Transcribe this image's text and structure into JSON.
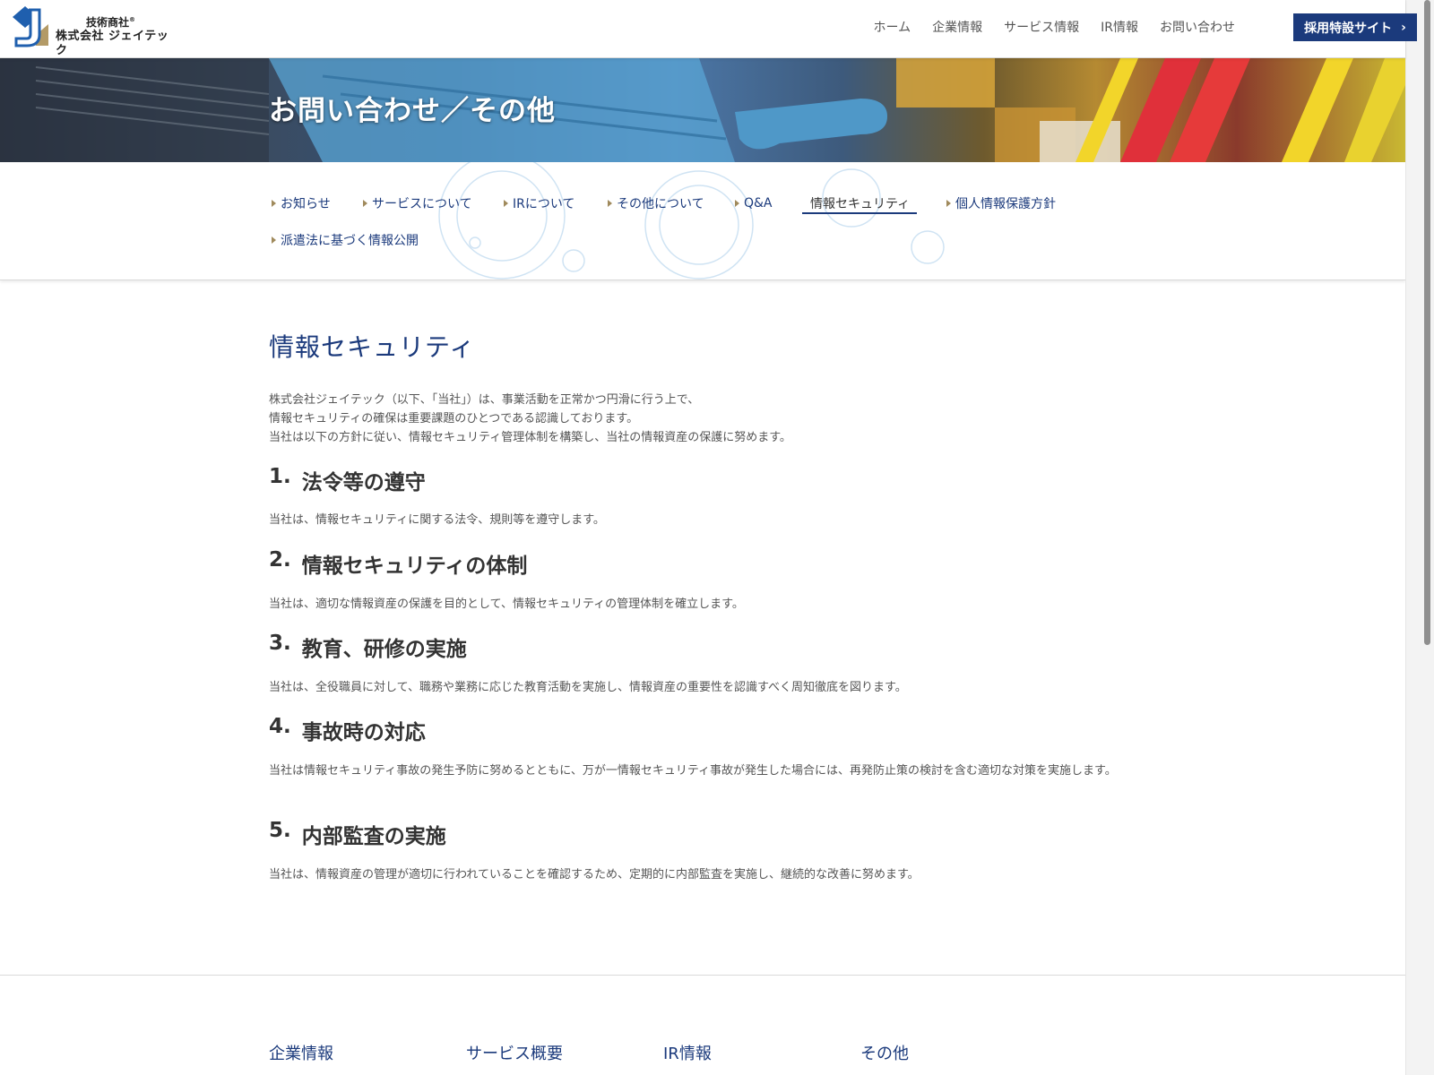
{
  "header": {
    "logo": {
      "tagline": "技術商社",
      "registered_mark": "®",
      "company_name": "株式会社 ジェイテック"
    },
    "nav": [
      {
        "label": "ホーム"
      },
      {
        "label": "企業情報"
      },
      {
        "label": "サービス情報"
      },
      {
        "label": "IR情報"
      },
      {
        "label": "お問い合わせ"
      }
    ],
    "recruit_button": {
      "label": "採用特設サイト",
      "icon": "chevron-right-icon"
    }
  },
  "hero": {
    "title": "お問い合わせ／その他"
  },
  "subnav": {
    "items": [
      {
        "label": "お知らせ"
      },
      {
        "label": "サービスについて"
      },
      {
        "label": "IRについて"
      },
      {
        "label": "その他について"
      },
      {
        "label": "Q&A"
      },
      {
        "label": "情報セキュリティ",
        "active": true
      },
      {
        "label": "個人情報保護方針"
      },
      {
        "label": "派遣法に基づく情報公開"
      }
    ]
  },
  "main": {
    "title": "情報セキュリティ",
    "intro": [
      "株式会社ジェイテック（以下、「当社」）は、事業活動を正常かつ円滑に行う上で、",
      "情報セキュリティの確保は重要課題のひとつである認識しております。",
      "当社は以下の方針に従い、情報セキュリティ管理体制を構築し、当社の情報資産の保護に努めます。"
    ],
    "sections": [
      {
        "number": "1.",
        "heading": "法令等の遵守",
        "body": "当社は、情報セキュリティに関する法令、規則等を遵守します。"
      },
      {
        "number": "2.",
        "heading": "情報セキュリティの体制",
        "body": "当社は、適切な情報資産の保護を目的として、情報セキュリティの管理体制を確立します。"
      },
      {
        "number": "3.",
        "heading": "教育、研修の実施",
        "body": "当社は、全役職員に対して、職務や業務に応じた教育活動を実施し、情報資産の重要性を認識すべく周知徹底を図ります。"
      },
      {
        "number": "4.",
        "heading": "事故時の対応",
        "body": "当社は情報セキュリティ事故の発生予防に努めるとともに、万が一情報セキュリティ事故が発生した場合には、再発防止策の検討を含む適切な対策を実施します。"
      },
      {
        "number": "5.",
        "heading": "内部監査の実施",
        "body": "当社は、情報資産の管理が適切に行われていることを確認するため、定期的に内部監査を実施し、継続的な改善に努めます。"
      }
    ]
  },
  "footer": {
    "categories": [
      {
        "label": "企業情報"
      },
      {
        "label": "サービス概要"
      },
      {
        "label": "IR情報"
      },
      {
        "label": "その他"
      }
    ]
  },
  "colors": {
    "brand_navy": "#1b3a7c",
    "accent_triangle": "#a08a5c",
    "logo_blue": "#1f5fae",
    "logo_gold": "#b39a66"
  }
}
